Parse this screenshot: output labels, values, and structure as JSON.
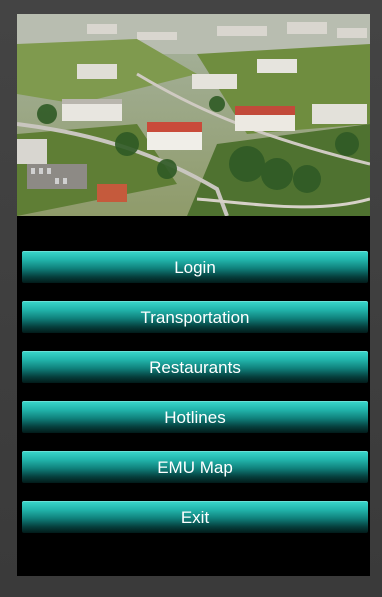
{
  "screen": {
    "hero_image": {
      "subject": "aerial campus photo"
    }
  },
  "menu": {
    "items": [
      {
        "label": "Login"
      },
      {
        "label": "Transportation"
      },
      {
        "label": "Restaurants"
      },
      {
        "label": "Hotlines"
      },
      {
        "label": "EMU Map"
      },
      {
        "label": "Exit"
      }
    ]
  },
  "colors": {
    "button_top": "#3ad8cc",
    "button_bottom": "#021a19",
    "screen_bg": "#000000",
    "device_frame": "#3d3d3d"
  }
}
